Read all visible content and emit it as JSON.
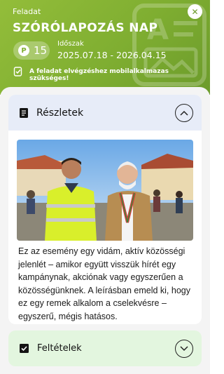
{
  "header": {
    "kicker": "Feladat",
    "title": "SZÓRÓLAPOZÁS NAP",
    "close_icon": "close-icon",
    "points": {
      "icon": "point-coin-icon",
      "coin_letter": "P",
      "value": "15"
    },
    "period": {
      "label": "Időszak",
      "value": "2025.07.18 - 2026.04.15"
    },
    "requirement": {
      "icon": "phone-check-icon",
      "text": "A feladat elvégzéshez mobilalkalmazas szükséges!"
    },
    "colors": {
      "gradient_start": "#93bd3a",
      "gradient_end": "#6c9b2b"
    }
  },
  "details": {
    "icon": "document-icon",
    "label": "Részletek",
    "toggle_icon": "chevron-up-icon",
    "expanded": true,
    "image": "photo-two-men-smiling-at-street-event",
    "description": "Ez az esemény egy vidám, aktív közösségi jelenlét – amikor együtt visszük hírét egy kampánynak, akciónak vagy egyszerűen a közösségünknek. A leírásban emeld ki, hogy ez egy remek alkalom a cselekvésre – egyszerű, mégis hatásos."
  },
  "conditions": {
    "icon": "checkbox-icon",
    "label": "Feltételek",
    "toggle_icon": "chevron-down-icon",
    "expanded": false
  }
}
